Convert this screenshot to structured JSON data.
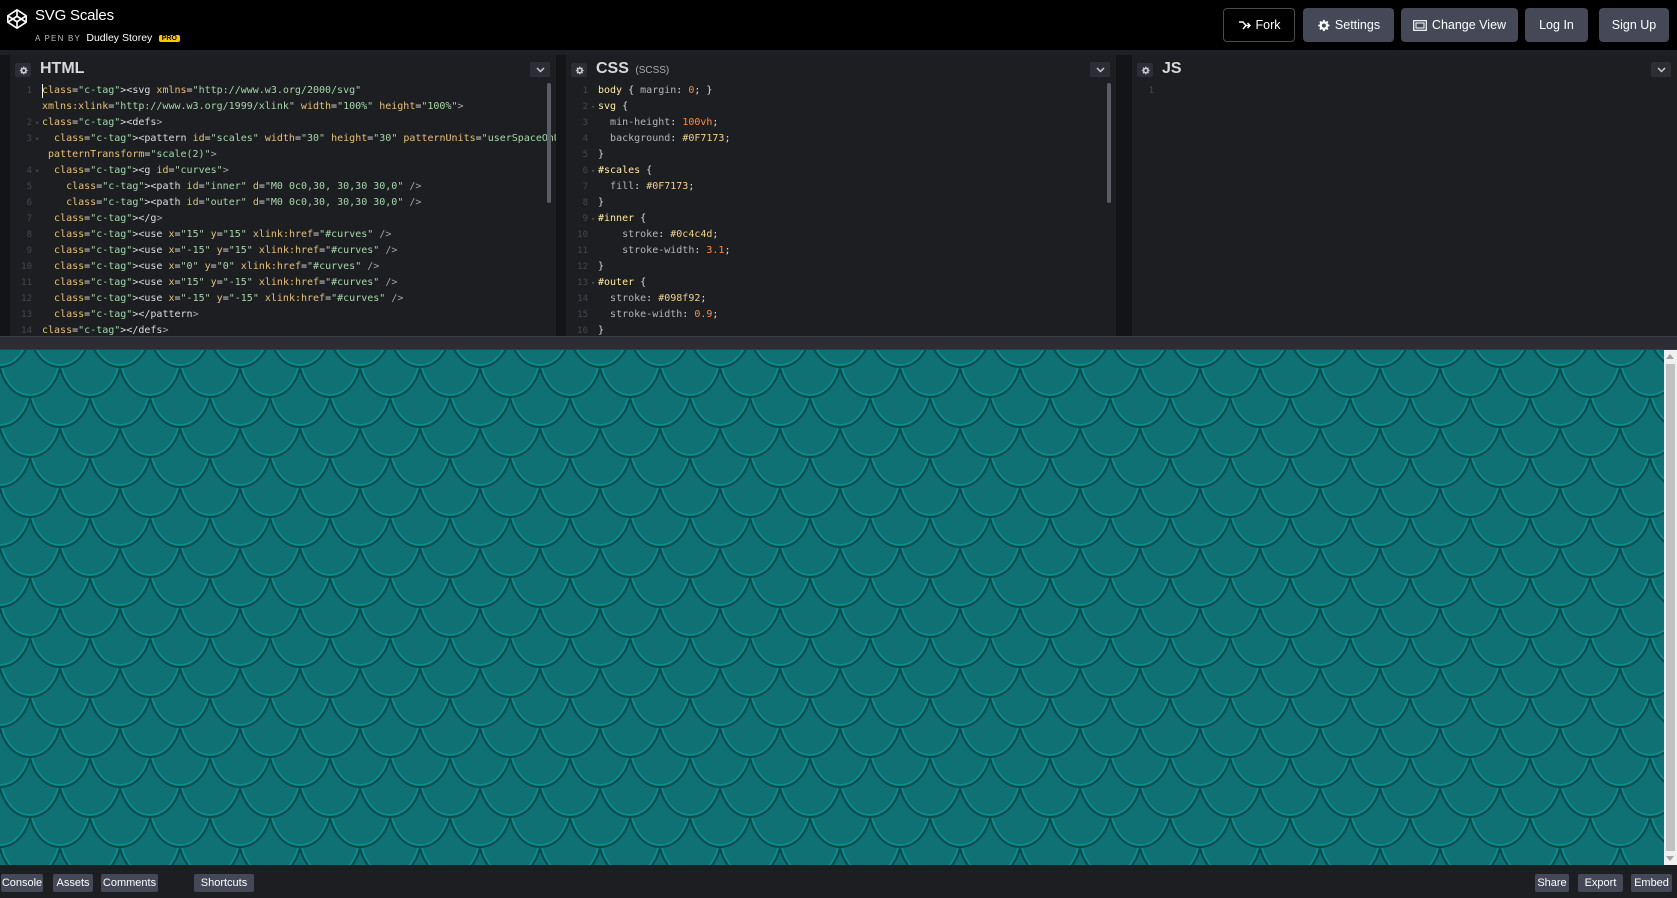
{
  "header": {
    "title": "SVG Scales",
    "byline_prefix": "A PEN BY",
    "author": "Dudley Storey",
    "badge": "PRO",
    "buttons": {
      "fork": "Fork",
      "settings": "Settings",
      "change_view": "Change View",
      "login": "Log In",
      "signup": "Sign Up"
    }
  },
  "editors": {
    "html": {
      "title": "HTML",
      "lines": [
        {
          "n": "1",
          "text": "<svg xmlns=\"http://www.w3.org/2000/svg\""
        },
        {
          "n": "",
          "text": "xmlns:xlink=\"http://www.w3.org/1999/xlink\" width=\"100%\" height=\"100%\">"
        },
        {
          "n": "2",
          "text": "<defs>"
        },
        {
          "n": "3",
          "text": "  <pattern id=\"scales\" width=\"30\" height=\"30\" patternUnits=\"userSpaceOnUse\""
        },
        {
          "n": "",
          "text": " patternTransform=\"scale(2)\">"
        },
        {
          "n": "4",
          "text": "  <g id=\"curves\">"
        },
        {
          "n": "5",
          "text": "    <path id=\"inner\" d=\"M0 0c0,30, 30,30 30,0\" />"
        },
        {
          "n": "6",
          "text": "    <path id=\"outer\" d=\"M0 0c0,30, 30,30 30,0\" />"
        },
        {
          "n": "7",
          "text": "  </g>"
        },
        {
          "n": "8",
          "text": "  <use x=\"15\" y=\"15\" xlink:href=\"#curves\" />"
        },
        {
          "n": "9",
          "text": "  <use x=\"-15\" y=\"15\" xlink:href=\"#curves\" />"
        },
        {
          "n": "10",
          "text": "  <use x=\"0\" y=\"0\" xlink:href=\"#curves\" />"
        },
        {
          "n": "11",
          "text": "  <use x=\"15\" y=\"-15\" xlink:href=\"#curves\" />"
        },
        {
          "n": "12",
          "text": "  <use x=\"-15\" y=\"-15\" xlink:href=\"#curves\" />"
        },
        {
          "n": "13",
          "text": "  </pattern>"
        },
        {
          "n": "14",
          "text": "</defs>"
        }
      ]
    },
    "css": {
      "title": "CSS",
      "subtitle": "(SCSS)",
      "lines": [
        {
          "n": "1",
          "text": "body { margin: 0; }"
        },
        {
          "n": "2",
          "text": "svg {"
        },
        {
          "n": "3",
          "text": "  min-height: 100vh;"
        },
        {
          "n": "4",
          "text": "  background: #0F7173;"
        },
        {
          "n": "5",
          "text": "}"
        },
        {
          "n": "6",
          "text": "#scales {"
        },
        {
          "n": "7",
          "text": "  fill: #0F7173;"
        },
        {
          "n": "8",
          "text": "}"
        },
        {
          "n": "9",
          "text": "#inner {"
        },
        {
          "n": "10",
          "text": "    stroke: #0c4c4d;"
        },
        {
          "n": "11",
          "text": "    stroke-width: 3.1;"
        },
        {
          "n": "12",
          "text": "}"
        },
        {
          "n": "13",
          "text": "#outer {"
        },
        {
          "n": "14",
          "text": "  stroke: #098f92;"
        },
        {
          "n": "15",
          "text": "  stroke-width: 0.9;"
        },
        {
          "n": "16",
          "text": "}"
        }
      ]
    },
    "js": {
      "title": "JS",
      "lines": [
        {
          "n": "1",
          "text": ""
        }
      ]
    }
  },
  "preview": {
    "background": "#0F7173",
    "scale_fill": "#0F7173",
    "inner_stroke": "#0c4c4d",
    "outer_stroke": "#098f92"
  },
  "footer": {
    "left": [
      "Console",
      "Assets",
      "Comments",
      "Shortcuts"
    ],
    "right": [
      "Share",
      "Export",
      "Embed"
    ]
  }
}
